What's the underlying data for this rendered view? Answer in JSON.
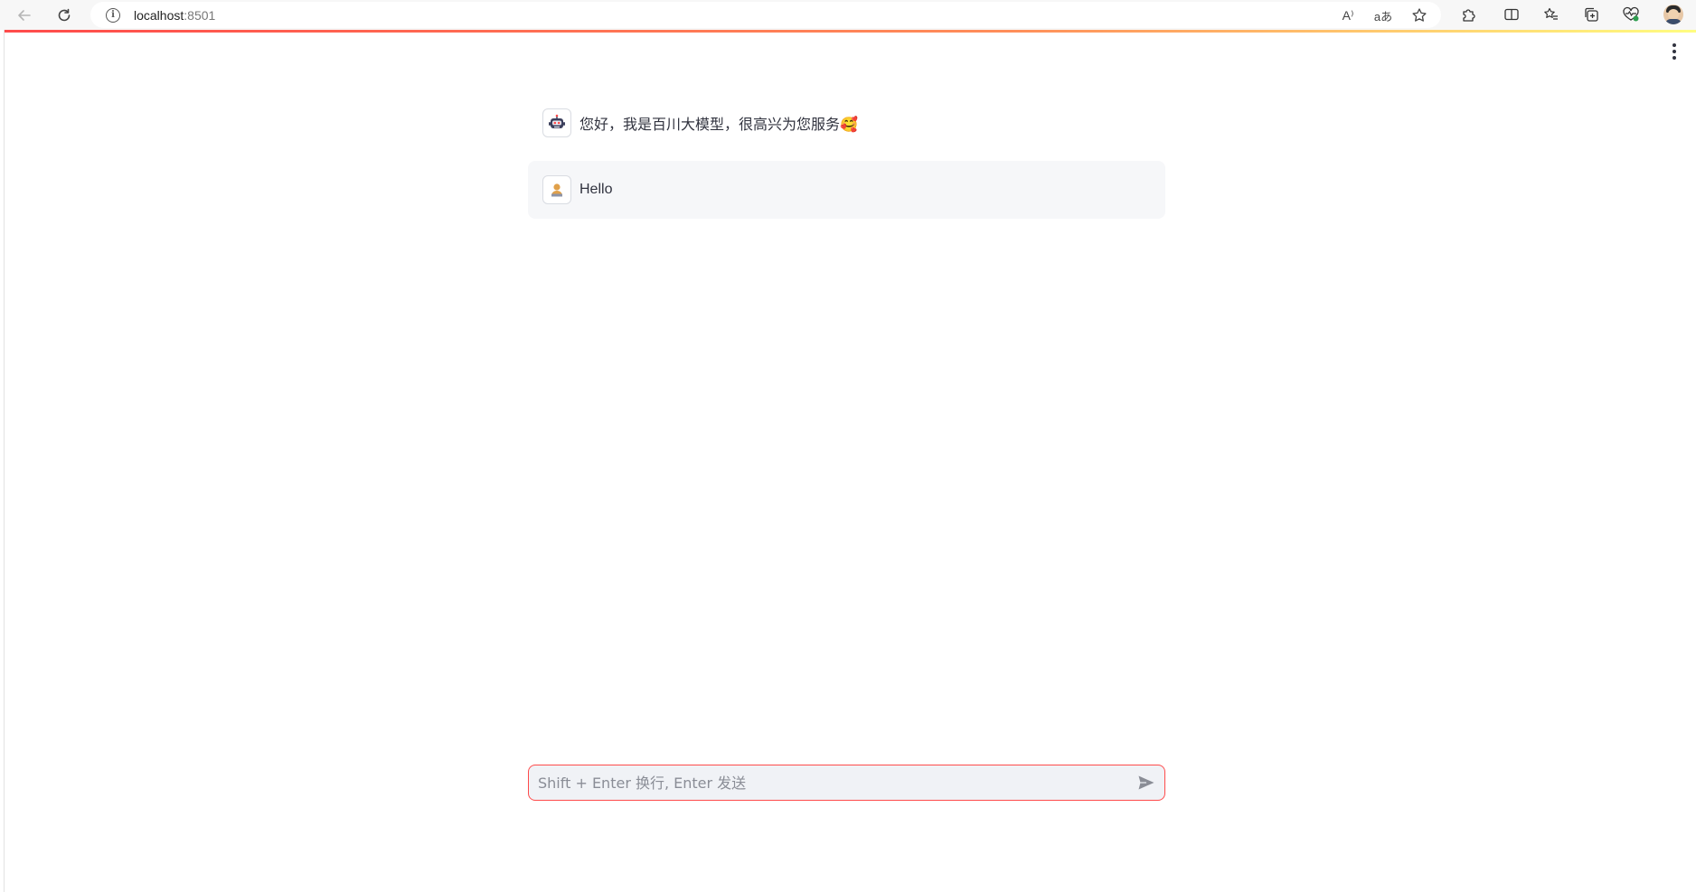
{
  "browser": {
    "url_host": "localhost",
    "url_port": ":8501",
    "icons": {
      "back": "back-arrow-icon",
      "reload": "reload-icon",
      "site_info": "info-icon",
      "read_aloud": "read-aloud-icon",
      "translate": "translate-icon",
      "favorite": "star-icon",
      "extensions": "puzzle-icon",
      "split_screen": "split-screen-icon",
      "favorites": "favorites-icon",
      "collections": "collections-icon",
      "performance": "heart-pulse-icon",
      "profile": "profile-avatar"
    },
    "translate_glyph": "aあ",
    "read_aloud_glyph": "A⁾"
  },
  "app": {
    "decoration_colors": [
      "#ff4b4b",
      "#ff8f5a",
      "#fffd80"
    ],
    "accent_color": "#ff4b4b",
    "menu_icon": "kebab-menu-icon"
  },
  "chat": {
    "messages": [
      {
        "role": "assistant",
        "avatar": "robot-icon",
        "text": "您好，我是百川大模型，很高兴为您服务🥰"
      },
      {
        "role": "user",
        "avatar": "person-icon",
        "text": "Hello"
      }
    ],
    "input": {
      "placeholder": "Shift + Enter 换行, Enter 发送",
      "value": "",
      "send_icon": "send-icon"
    }
  }
}
